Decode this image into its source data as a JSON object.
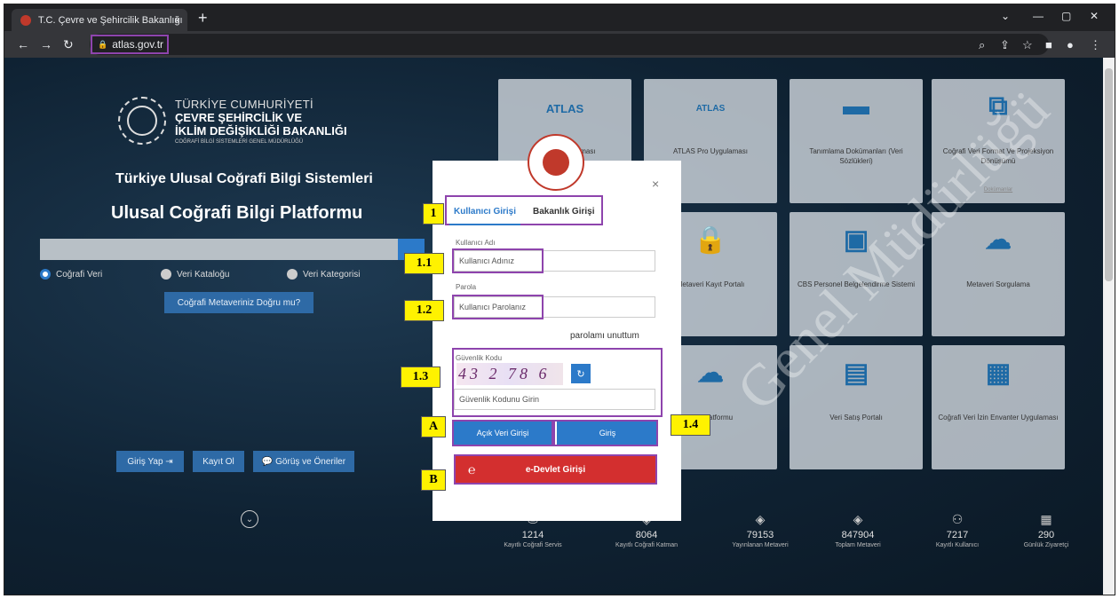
{
  "browser": {
    "tab_title": "T.C. Çevre ve Şehircilik Bakanlığı",
    "tab_close": "×",
    "new_tab": "+",
    "url": "atlas.gov.tr"
  },
  "header": {
    "line1": "TÜRKİYE CUMHURİYETİ",
    "line2": "ÇEVRE ŞEHİRCİLİK VE",
    "line3": "İKLİM DEĞİŞİKLİĞİ BAKANLIĞI",
    "line4": "COĞRAFİ BİLGİ SİSTEMLERİ GENEL MÜDÜRLÜĞÜ"
  },
  "left": {
    "subtitle": "Türkiye Ulusal Coğrafi Bilgi Sistemleri",
    "title": "Ulusal Coğrafi Bilgi Platformu",
    "radio1": "Coğrafi Veri",
    "radio2": "Veri Kataloğu",
    "radio3": "Veri Kategorisi",
    "meta_button": "Coğrafi Metaveriniz Doğru mu?",
    "login": "Giriş Yap",
    "register": "Kayıt Ol",
    "feedback": "Görüş ve Öneriler"
  },
  "cards": [
    {
      "title": "ATLAS Uygulaması",
      "icon": "ATLAS"
    },
    {
      "title": "ATLAS Pro Uygulaması",
      "icon": "ATLAS"
    },
    {
      "title": "Tanımlama Dokümanları (Veri Sözlükleri)",
      "icon": "folder-icon"
    },
    {
      "title": "Coğrafi Veri Format Ve Projeksiyon Dönüşümü",
      "icon": "network-icon",
      "doc": "Dokümanlar"
    },
    {
      "title": "Metaveri Kayıt Portalı",
      "icon": "lock-icon"
    },
    {
      "title": "CBS Personel Belgelendirme Sistemi",
      "icon": "id-card-icon"
    },
    {
      "title": "Metaveri Sorgulama",
      "icon": "cloud-icon"
    },
    {
      "title": "Veri Platformu",
      "icon": "cloud-network-icon"
    },
    {
      "title": "Veri Satış Portalı",
      "icon": "map-icon"
    },
    {
      "title": "Coğrafi Veri İzin Envanter Uygulaması",
      "icon": "document-icon"
    }
  ],
  "doc_link": "Dokümanlar",
  "stats": [
    {
      "value": "1214",
      "label": "Kayıtlı Coğrafi Servis"
    },
    {
      "value": "8064",
      "label": "Kayıtlı Coğrafi Katman"
    },
    {
      "value": "79153",
      "label": "Yayınlanan Metaveri"
    },
    {
      "value": "847904",
      "label": "Toplam Metaveri"
    },
    {
      "value": "7217",
      "label": "Kayıtlı Kullanıcı"
    },
    {
      "value": "290",
      "label": "Günlük Ziyaretçi"
    }
  ],
  "modal": {
    "close": "×",
    "tab_user": "Kullanıcı Girişi",
    "tab_ministry": "Bakanlık Girişi",
    "username_label": "Kullanıcı Adı",
    "username_placeholder": "Kullanıcı Adınız",
    "password_label": "Parola",
    "password_placeholder": "Kullanıcı Parolanız",
    "forgot": "parolamı unuttum",
    "security_label": "Güvenlik Kodu",
    "captcha": "43 2 78 6",
    "security_placeholder": "Güvenlik Kodunu Girin",
    "open_data_button": "Açık Veri Girişi",
    "login_button": "Giriş",
    "edevlet_button": "e-Devlet Girişi"
  },
  "markers": {
    "m1": "1",
    "m11": "1.1",
    "m12": "1.2",
    "m13": "1.3",
    "m14": "1.4",
    "mA": "A",
    "mB": "B"
  },
  "watermark": "Genel Müdürlüğü",
  "colors": {
    "accent": "#2c7ac9",
    "highlight": "#8e44ad",
    "marker": "#fff200",
    "edevlet": "#d32f2f"
  }
}
